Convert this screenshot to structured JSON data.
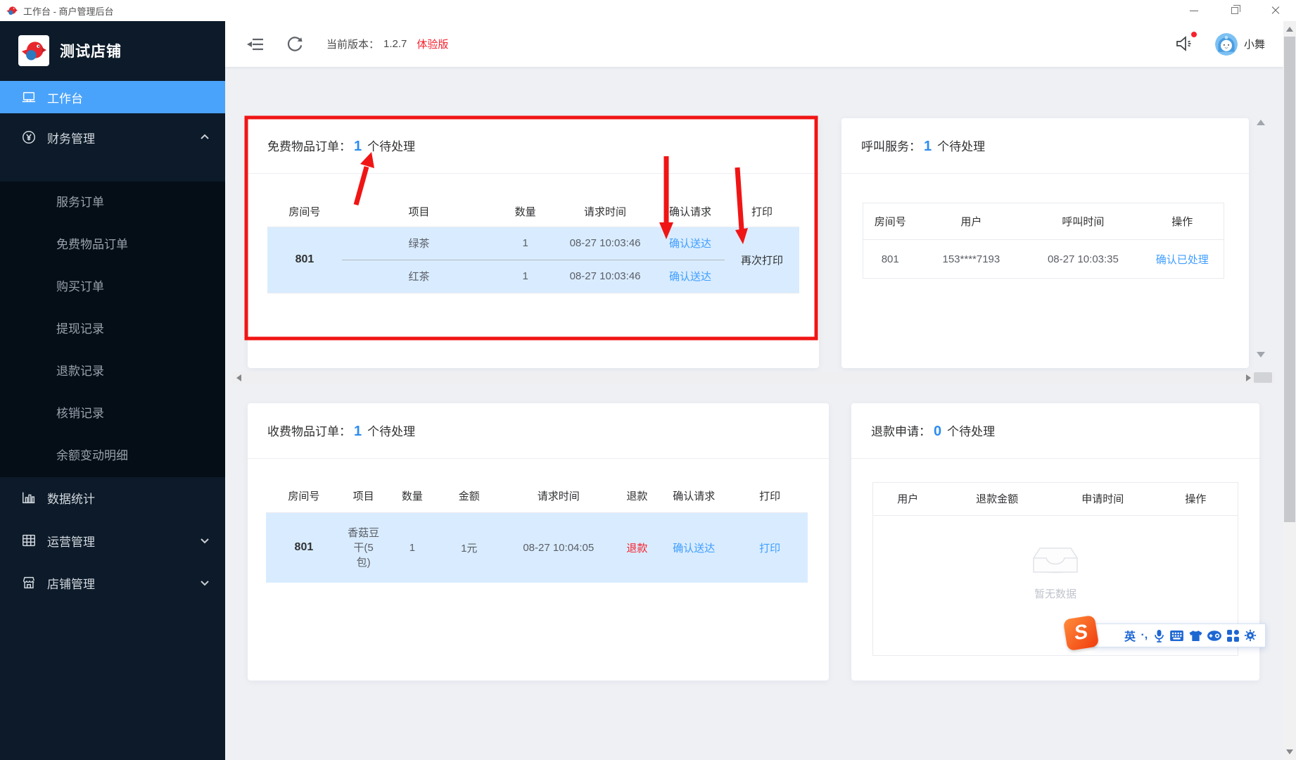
{
  "window": {
    "title": "工作台 - 商户管理后台"
  },
  "sidebar": {
    "store_name": "测试店铺",
    "workbench": "工作台",
    "finance": "财务管理",
    "finance_children": [
      "服务订单",
      "免费物品订单",
      "购买订单",
      "提现记录",
      "退款记录",
      "核销记录",
      "余额变动明细"
    ],
    "stats": "数据统计",
    "operations": "运营管理",
    "shop": "店铺管理"
  },
  "topbar": {
    "version_label": "当前版本：",
    "version": "1.2.7",
    "badge": "体验版",
    "username": "小舞"
  },
  "cards": {
    "free": {
      "title": "免费物品订单：",
      "count": "1",
      "count_suffix": "个待处理",
      "headers": [
        "房间号",
        "项目",
        "数量",
        "请求时间",
        "确认请求",
        "打印"
      ],
      "room": "801",
      "rows": [
        {
          "item": "绿茶",
          "qty": "1",
          "time": "08-27 10:03:46",
          "confirm": "确认送达"
        },
        {
          "item": "红茶",
          "qty": "1",
          "time": "08-27 10:03:46",
          "confirm": "确认送达"
        }
      ],
      "print_action": "再次打印"
    },
    "call": {
      "title": "呼叫服务：",
      "count": "1",
      "count_suffix": "个待处理",
      "headers": [
        "房间号",
        "用户",
        "呼叫时间",
        "操作"
      ],
      "row": {
        "room": "801",
        "user": "153****7193",
        "time": "08-27 10:03:35",
        "action": "确认已处理"
      }
    },
    "paid": {
      "title": "收费物品订单：",
      "count": "1",
      "count_suffix": "个待处理",
      "headers": [
        "房间号",
        "项目",
        "数量",
        "金额",
        "请求时间",
        "退款",
        "确认请求",
        "打印"
      ],
      "row": {
        "room": "801",
        "item": "香菇豆干(5包)",
        "qty": "1",
        "amount": "1元",
        "time": "08-27 10:04:05",
        "refund": "退款",
        "confirm": "确认送达",
        "print": "打印"
      }
    },
    "refund": {
      "title": "退款申请：",
      "count": "0",
      "count_suffix": "个待处理",
      "headers": [
        "用户",
        "退款金额",
        "申请时间",
        "操作"
      ],
      "empty_text": "暂无数据"
    }
  },
  "ime": {
    "logo": "S",
    "mode": "英",
    "punct": "·,"
  },
  "colors": {
    "accent_blue": "#2d8cf0",
    "link_blue": "#409eff",
    "danger_red": "#f5222d",
    "row_highlight": "#d9ecff",
    "annotation_red": "#f01515",
    "sidebar_bg": "#0c1a29",
    "sidebar_active": "#4aa3fa"
  }
}
